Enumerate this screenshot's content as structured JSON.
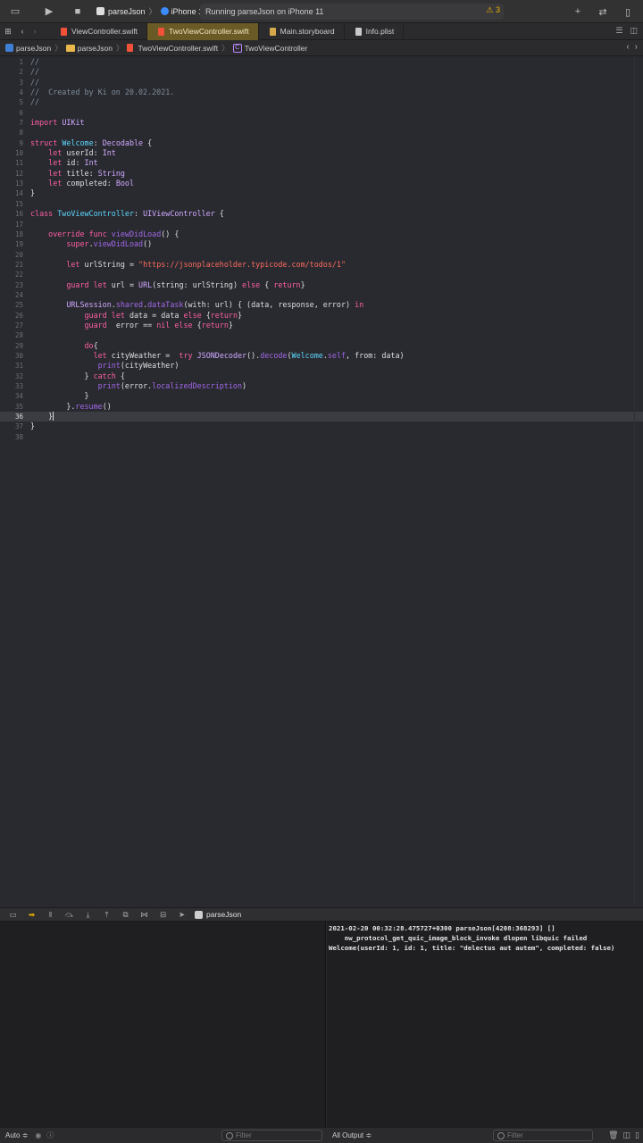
{
  "toolbar": {
    "scheme": "parseJson",
    "device": "iPhone 11",
    "status": "Running parseJson on iPhone 11",
    "warnings": "3"
  },
  "tabs": [
    {
      "label": "ViewController.swift",
      "icon": "swift-file-icon"
    },
    {
      "label": "TwoViewController.swift",
      "icon": "swift-file-icon",
      "active": true
    },
    {
      "label": "Main.storyboard",
      "icon": "storyboard-file-icon"
    },
    {
      "label": "Info.plist",
      "icon": "plist-file-icon"
    }
  ],
  "breadcrumb": {
    "project": "parseJson",
    "group": "parseJson",
    "file": "TwoViewController.swift",
    "symbol": "TwoViewController"
  },
  "editor": {
    "current_line": 36,
    "lines": [
      "//",
      "//",
      "//",
      "//  Created by Ki on 20.02.2021.",
      "//",
      "",
      "import UIKit",
      "",
      "struct Welcome: Decodable {",
      "    let userId: Int",
      "    let id: Int",
      "    let title: String",
      "    let completed: Bool",
      "}",
      "",
      "class TwoViewController: UIViewController {",
      "",
      "    override func viewDidLoad() {",
      "        super.viewDidLoad()",
      "",
      "        let urlString = \"https://jsonplaceholder.typicode.com/todos/1\"",
      "",
      "        guard let url = URL(string: urlString) else { return}",
      "",
      "        URLSession.shared.dataTask(with: url) { (data, response, error) in",
      "            guard let data = data else {return}",
      "            guard  error == nil else {return}",
      "",
      "            do{",
      "              let cityWeather =  try JSONDecoder().decode(Welcome.self, from: data)",
      "               print(cityWeather)",
      "            } catch {",
      "               print(error.localizedDescription)",
      "            }",
      "        }.resume()",
      "    }",
      "}",
      ""
    ]
  },
  "debug": {
    "process": "parseJson"
  },
  "console": {
    "lines": [
      "2021-02-20 00:32:28.475727+0300 parseJson[4208:368293] []",
      "    nw_protocol_get_quic_image_block_invoke dlopen libquic failed",
      "Welcome(userId: 1, id: 1, title: \"delectus aut autem\", completed: false)"
    ]
  },
  "bottom": {
    "variables_mode": "Auto ≑",
    "variables_filter_placeholder": "Filter",
    "output_mode": "All Output ≑",
    "console_filter_placeholder": "Filter"
  }
}
